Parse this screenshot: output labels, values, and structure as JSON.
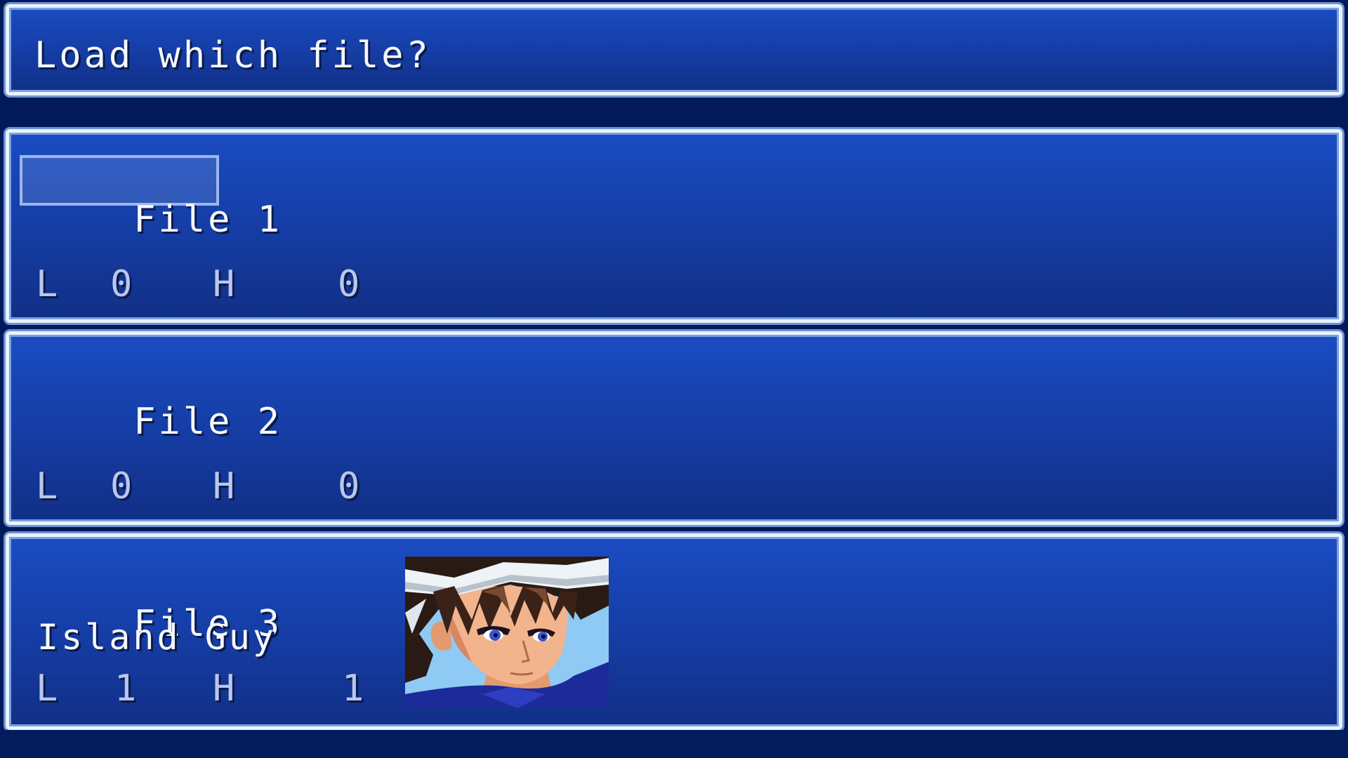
{
  "prompt": {
    "title": "Load which file?"
  },
  "slots": [
    {
      "label": "File",
      "number": "1",
      "name": "",
      "stat_l_label": "L",
      "stat_l_value": "0",
      "stat_h_label": "H",
      "stat_h_value": "0",
      "selected": true
    },
    {
      "label": "File",
      "number": "2",
      "name": "",
      "stat_l_label": "L",
      "stat_l_value": "0",
      "stat_h_label": "H",
      "stat_h_value": "0",
      "selected": false
    },
    {
      "label": "File",
      "number": "3",
      "name": "Island Guy",
      "stat_l_label": "L",
      "stat_l_value": "1",
      "stat_h_label": "H",
      "stat_h_value": "1",
      "selected": false,
      "portrait": "character-portrait-brown-hair-headband"
    }
  ],
  "colors": {
    "window_bg": "#163fa9",
    "window_border": "#e8f4ff",
    "text": "#f5f8ff",
    "stat_text": "#b9c7ee",
    "cursor": "#9fb6ea"
  }
}
